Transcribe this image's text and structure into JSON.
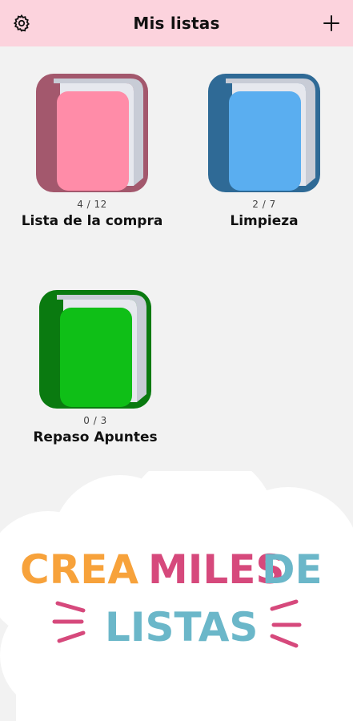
{
  "header": {
    "title": "Mis listas",
    "settings_icon": "gear-icon",
    "add_icon": "plus-icon"
  },
  "lists": [
    {
      "count": "4 / 12",
      "name": "Lista de la compra",
      "color": "#ff8ca8",
      "spine": "#a3586d"
    },
    {
      "count": "2 / 7",
      "name": "Limpieza",
      "color": "#5aaef0",
      "spine": "#2f6a96"
    },
    {
      "count": "0 / 3",
      "name": "Repaso Apuntes",
      "color": "#0fbf17",
      "spine": "#0a7a10"
    }
  ],
  "promo": {
    "word1": "CREA",
    "word2": "MILES",
    "word3": "DE",
    "word4": "LISTAS",
    "colors": {
      "orange": "#f7a23b",
      "pink": "#d6497c",
      "blue": "#6bb7c9"
    }
  }
}
